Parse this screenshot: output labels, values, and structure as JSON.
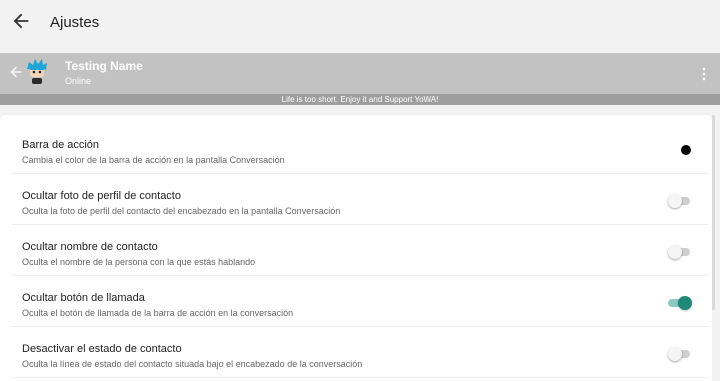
{
  "appbar": {
    "title": "Ajustes",
    "back_icon": "arrow-left-icon"
  },
  "preview": {
    "back_icon": "arrow-left-icon",
    "avatar_icon": "avatar-icon",
    "contact_name": "Testing Name",
    "contact_status": "Online",
    "menu_icon": "more-vert-icon",
    "background_color": "#c2c2c2"
  },
  "banner": {
    "text": "Life is too short. Enjoy it and Support YoWA!"
  },
  "settings": [
    {
      "title": "Barra de acción",
      "subtitle": "Cambia el color de la barra de acción en la pantalla Conversación",
      "control": "color",
      "color": "#000000"
    },
    {
      "title": "Ocultar foto de perfil de contacto",
      "subtitle": "Oculta la foto de perfil del contacto del encabezado en la pantalla Conversación",
      "control": "switch",
      "checked": false
    },
    {
      "title": "Ocultar nombre de contacto",
      "subtitle": "Oculta el nombre de la persona con la que estás hablando",
      "control": "switch",
      "checked": false
    },
    {
      "title": "Ocultar botón de llamada",
      "subtitle": "Oculta el botón de llamada de la barra de acción en la conversación",
      "control": "switch",
      "checked": true
    },
    {
      "title": "Desactivar el estado de contacto",
      "subtitle": "Oculta la línea de estado del contacto situada bajo el encabezado de la conversación",
      "control": "switch",
      "checked": false
    }
  ],
  "colors": {
    "accent": "#1f8a78"
  }
}
